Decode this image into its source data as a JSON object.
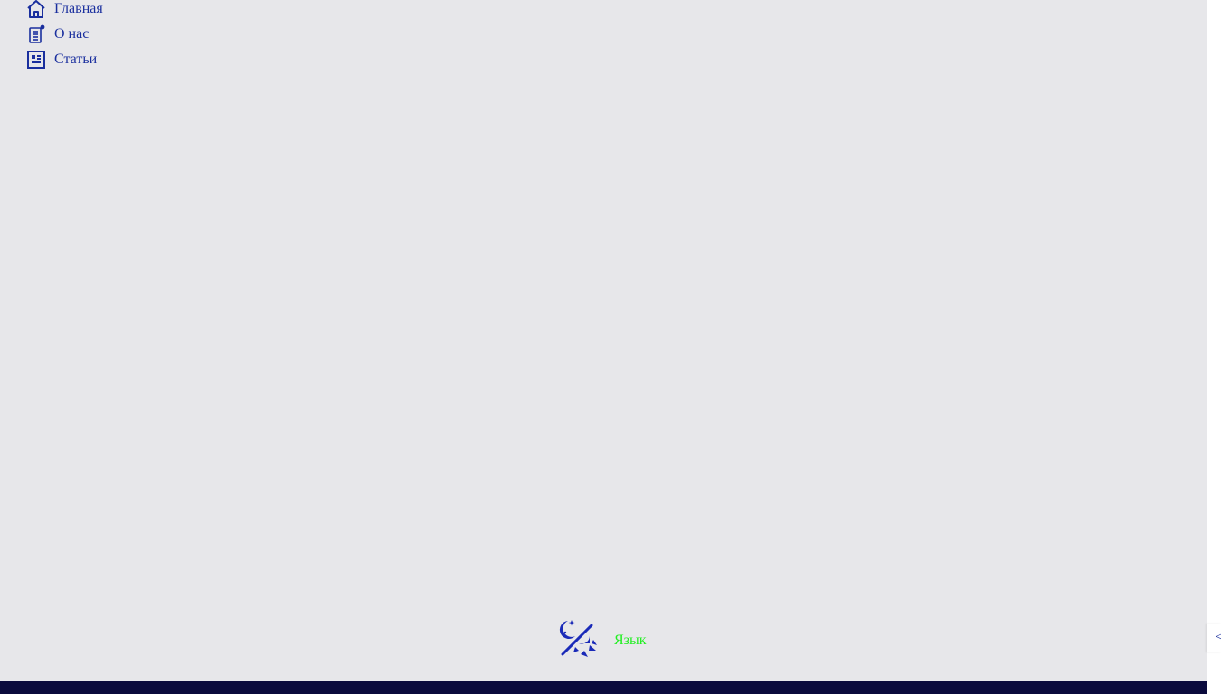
{
  "nav": {
    "items": [
      {
        "label": "Главная",
        "icon": "home-icon"
      },
      {
        "label": "О нас",
        "icon": "document-info-icon"
      },
      {
        "label": "Статьи",
        "icon": "articles-icon"
      }
    ]
  },
  "controls": {
    "theme_icon": "theme-toggle-icon",
    "language_label": "Язык"
  },
  "collapse": {
    "label": "<"
  },
  "colors": {
    "sidebar_bg": "#e7e7ea",
    "accent": "#1a2f9e",
    "language_text": "#22ee22",
    "footer": "#0a0a3c"
  }
}
